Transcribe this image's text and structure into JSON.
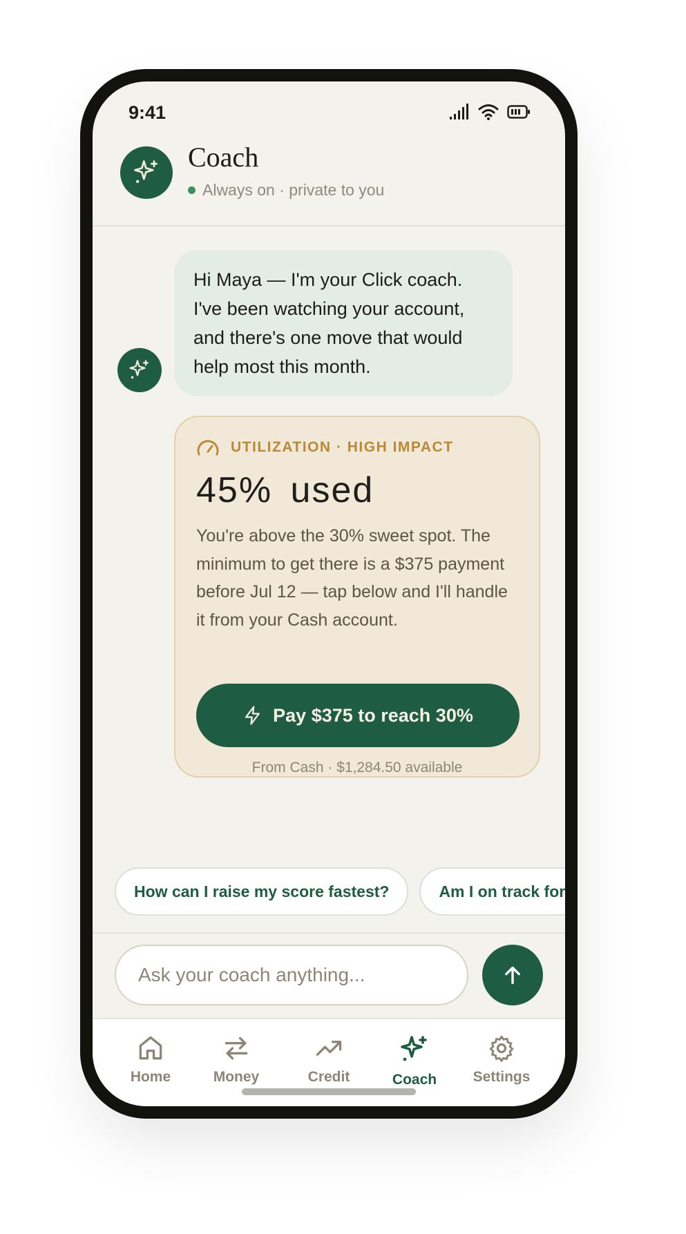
{
  "status": {
    "time": "9:41"
  },
  "header": {
    "title": "Coach",
    "subtitle": "Always on · private to you"
  },
  "message": {
    "text": "Hi Maya — I'm your Click coach. I've been watching your account, and there's one move that would help most this month."
  },
  "card": {
    "tag": "UTILIZATION · HIGH IMPACT",
    "headline": "45% used",
    "utilization_percent": 45,
    "body": "You're above the 30% sweet spot. The minimum to get there is a $375 payment before Jul 12 — tap below and I'll handle it from your Cash account.",
    "button_label": "Pay $375 to reach 30%",
    "footnote": "From Cash · $1,284.50 available"
  },
  "suggestions": [
    "How can I raise my score fastest?",
    "Am I on track for"
  ],
  "composer": {
    "placeholder": "Ask your coach anything..."
  },
  "tabs": [
    {
      "label": "Home",
      "icon": "home-icon"
    },
    {
      "label": "Money",
      "icon": "transfer-arrows-icon"
    },
    {
      "label": "Credit",
      "icon": "trending-up-icon"
    },
    {
      "label": "Coach",
      "icon": "sparkle-icon",
      "active": true
    },
    {
      "label": "Settings",
      "icon": "gear-icon"
    }
  ],
  "colors": {
    "brand": "#1f5c44",
    "background": "#f4f2ec",
    "card": "#f1e8d7",
    "accent": "#b98a35",
    "bubble": "#e4ece6"
  }
}
